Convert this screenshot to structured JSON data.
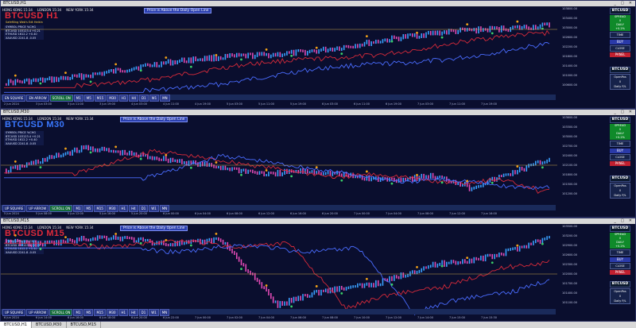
{
  "app": {
    "colors": {
      "bg": "#0a0e2e",
      "up": "#3aa0ff",
      "down": "#e24ab5",
      "ma_red": "#d62a3a",
      "ma_blue": "#4a6cff",
      "ma_green": "#3ad06a",
      "gold": "#f2a218"
    }
  },
  "sessions": {
    "hk": "HONG KONG 15:34",
    "ldn": "LONDON 15:34",
    "ny": "NEW YORK 15:34"
  },
  "notice": "Price is Above the Daily Open Line",
  "panes": [
    {
      "title": "BTCUSD,H1",
      "symbol_title": "BTCUSD H1",
      "subtitle": "Safefiling Web's Edt Heikin",
      "mini_rows": [
        "SYMBOL PRICE %CHG",
        "BTCUSD 103123.4 +0.21",
        "ETHUSD 1612.2 +0.40",
        "XAUUSD 2241.8 -0.05"
      ],
      "axis": [
        "103800.00",
        "103400.00",
        "103000.00",
        "102600.00",
        "102200.00",
        "101800.00",
        "101400.00",
        "101000.00",
        "100600.00"
      ],
      "side": {
        "title": "BTCUSD",
        "green": [
          "SPREAD",
          "0",
          "DAILY",
          "+0.2%"
        ],
        "tf": "TIME",
        "sell": "SELL",
        "buy": "BUY",
        "close": "CLOSE",
        "panel": "PANEL",
        "info_title": "BTCUSD",
        "info": [
          "OpenPos",
          "0",
          "Daily P/L"
        ]
      },
      "bottom": [
        "EN SQUARE",
        "EN ARROW",
        "SCROLL ON",
        "M1",
        "M5",
        "M15",
        "M30",
        "H1",
        "H4",
        "D1",
        "W1",
        "MN"
      ],
      "times": [
        "2 Jun 2024",
        "3 Jun 03:00",
        "3 Jun 11:00",
        "3 Jun 19:00",
        "4 Jun 03:00",
        "4 Jun 11:00",
        "4 Jun 19:00",
        "5 Jun 03:00",
        "5 Jun 11:00",
        "5 Jun 19:00",
        "6 Jun 03:00",
        "6 Jun 11:00",
        "6 Jun 19:00",
        "7 Jun 03:00",
        "7 Jun 11:00",
        "7 Jun 19:00"
      ]
    },
    {
      "title": "BTCUSD,M30",
      "symbol_title": "BTCUSD M30",
      "subtitle": "",
      "mini_rows": [
        "SYMBOL PRICE %CHG",
        "BTCUSD 103123.4 +0.21",
        "ETHUSD 1612.2 +0.40",
        "XAUUSD 2241.8 -0.05"
      ],
      "axis": [
        "103600.00",
        "103300.00",
        "103000.00",
        "102700.00",
        "102400.00",
        "102100.00",
        "101800.00",
        "101500.00",
        "101200.00"
      ],
      "side": {
        "title": "BTCUSD",
        "green": [
          "SPREAD",
          "0",
          "DAILY",
          "+0.2%"
        ],
        "tf": "TIME",
        "sell": "SELL",
        "buy": "BUY",
        "close": "CLOSE",
        "panel": "PANEL",
        "info_title": "BTCUSD",
        "info": [
          "OpenPos",
          "0",
          "Daily P/L"
        ]
      },
      "bottom": [
        "UP SQUARE",
        "UP ARROW",
        "SCROLL ON",
        "M1",
        "M5",
        "M15",
        "M30",
        "H1",
        "H4",
        "D1",
        "W1",
        "MN"
      ],
      "times": [
        "5 Jun 2024",
        "5 Jun 08:00",
        "5 Jun 12:00",
        "5 Jun 16:00",
        "5 Jun 20:00",
        "6 Jun 00:00",
        "6 Jun 04:00",
        "6 Jun 08:00",
        "6 Jun 12:00",
        "6 Jun 16:00",
        "6 Jun 20:00",
        "7 Jun 00:00",
        "7 Jun 04:00",
        "7 Jun 08:00",
        "7 Jun 12:00",
        "7 Jun 16:00"
      ]
    },
    {
      "title": "BTCUSD,M15",
      "symbol_title": "BTCUSD M15",
      "subtitle": "",
      "mini_rows": [
        "SYMBOL PRICE %CHG",
        "BTCUSD 103123.4 +0.21",
        "ETHUSD 1612.2 +0.40",
        "XAUUSD 2241.8 -0.05"
      ],
      "axis": [
        "103500.00",
        "103200.00",
        "102900.00",
        "102600.00",
        "102300.00",
        "102000.00",
        "101700.00",
        "101400.00",
        "101100.00"
      ],
      "side": {
        "title": "BTCUSD",
        "green": [
          "SPREAD",
          "0",
          "DAILY",
          "+0.2%"
        ],
        "tf": "TIME",
        "sell": "SELL",
        "buy": "BUY",
        "close": "CLOSE",
        "panel": "PANEL",
        "info_title": "BTCUSD",
        "info": [
          "OpenPos",
          "0",
          "Daily P/L"
        ]
      },
      "bottom": [
        "UP SQUARE",
        "UP ARROW",
        "SCROLL ON",
        "M1",
        "M5",
        "M15",
        "M30",
        "H1",
        "H4",
        "D1",
        "W1",
        "MN"
      ],
      "times": [
        "6 Jun 2024",
        "6 Jun 14:00",
        "6 Jun 16:00",
        "6 Jun 18:00",
        "6 Jun 20:00",
        "6 Jun 22:00",
        "7 Jun 00:00",
        "7 Jun 02:00",
        "7 Jun 04:00",
        "7 Jun 06:00",
        "7 Jun 08:00",
        "7 Jun 10:00",
        "7 Jun 12:00",
        "7 Jun 14:00",
        "7 Jun 15:00",
        "7 Jun 15:30"
      ]
    }
  ],
  "tabs": [
    "BTCUSD,H1",
    "BTCUSD,M30",
    "BTCUSD,M15"
  ]
}
